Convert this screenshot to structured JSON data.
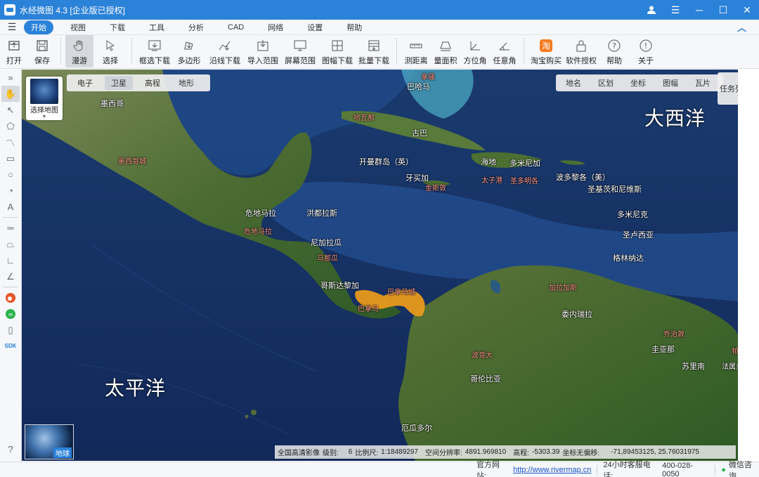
{
  "window": {
    "title": "水经微图 4.3 [企业版已授权]"
  },
  "menu": [
    "开始",
    "视图",
    "下载",
    "工具",
    "分析",
    "CAD",
    "网络",
    "设置",
    "帮助"
  ],
  "toolbar": [
    "打开",
    "保存",
    "漫游",
    "选择",
    "框选下载",
    "多边形",
    "沿线下载",
    "导入范围",
    "屏幕范围",
    "图幅下载",
    "批量下载",
    "测距离",
    "量面积",
    "方位角",
    "任意角",
    "淘宝购买",
    "软件授权",
    "帮助",
    "关于"
  ],
  "map_selector": {
    "label": "选择地图"
  },
  "map_types": [
    "电子",
    "卫星",
    "高程",
    "地形"
  ],
  "layers": [
    "地名",
    "区划",
    "坐标",
    "图幅",
    "瓦片"
  ],
  "task_list": "任务列表",
  "oceans": {
    "atlantic": "大西洋",
    "pacific": "太平洋"
  },
  "places": {
    "bahamas": "巴哈马",
    "nassau": "拿骚",
    "mexico": "墨西哥",
    "havana": "哈瓦那",
    "cuba": "古巴",
    "cayman": "开曼群岛（英）",
    "haiti": "海地",
    "dominican": "多米尼加",
    "jamaica": "牙买加",
    "kingston": "金斯敦",
    "portauprince": "太子港",
    "santodomingo": "圣多明各",
    "puertorico": "波多黎各（美）",
    "stkitts": "圣基茨和尼维斯",
    "dominica": "多米尼克",
    "stlucia": "圣卢西亚",
    "grenada": "格林纳达",
    "mexicocity": "墨西哥城",
    "guatemala": "危地马拉",
    "guatemalacity": "危地马拉",
    "honduras": "洪都拉斯",
    "nicaragua": "尼加拉瓜",
    "managua": "马那瓜",
    "costarica": "哥斯达黎加",
    "panama": "巴拿马",
    "panamacity": "巴拿马城",
    "venezuela": "委内瑞拉",
    "caracas": "加拉加斯",
    "colombia": "哥伦比亚",
    "bogota": "波哥大",
    "guyana": "圭亚那",
    "georgetown": "乔治敦",
    "suriname": "苏里南",
    "paramaribo": "帕拉马",
    "frenchguiana": "法属圭亚那",
    "ecuador": "厄瓜多尔"
  },
  "globe": {
    "label": "地球"
  },
  "status": {
    "source": "全国高清影像",
    "level_label": "级别:",
    "level": "6",
    "scale_label": "比例尺:",
    "scale": "1:18489297",
    "resolution_label": "空间分辨率:",
    "resolution": "4891.969810",
    "elevation_label": "高程:",
    "elevation": "-5303.39",
    "coord_label": "坐标无偏移:",
    "coord": "-71,89453125, 25.76031975"
  },
  "footer": {
    "site_label": "官方网站:",
    "site_url": "http://www.rivermap.cn",
    "hotline_label": "24小时客服电话:",
    "hotline": "400-028-0050",
    "wechat": "微信咨询"
  },
  "colors": {
    "brand": "#2b82d9",
    "panama_highlight": "#e89a1b",
    "ocean": "#17325e",
    "land": "#4d6b35"
  }
}
